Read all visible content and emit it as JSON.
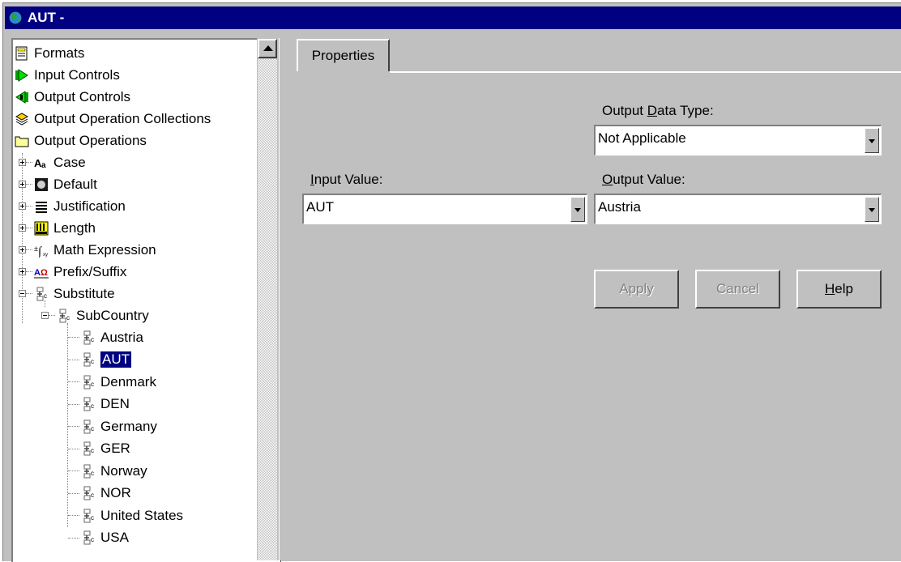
{
  "window": {
    "title": "AUT -"
  },
  "tree": {
    "top_items": [
      {
        "label": "Formats",
        "icon": "formats-icon"
      },
      {
        "label": "Input Controls",
        "icon": "input-controls-icon"
      },
      {
        "label": "Output Controls",
        "icon": "output-controls-icon"
      },
      {
        "label": "Output Operation Collections",
        "icon": "collections-icon"
      },
      {
        "label": "Output Operations",
        "icon": "folder-icon"
      }
    ],
    "operations": [
      {
        "label": "Case",
        "icon": "case-icon"
      },
      {
        "label": "Default",
        "icon": "default-icon"
      },
      {
        "label": "Justification",
        "icon": "justification-icon"
      },
      {
        "label": "Length",
        "icon": "length-icon"
      },
      {
        "label": "Math Expression",
        "icon": "math-expression-icon"
      },
      {
        "label": "Prefix/Suffix",
        "icon": "prefix-suffix-icon"
      },
      {
        "label": "Substitute",
        "icon": "substitute-icon"
      }
    ],
    "subgroup": {
      "label": "SubCountry",
      "icon": "substitute-icon"
    },
    "values": [
      "Austria",
      "AUT",
      "Denmark",
      "DEN",
      "Germany",
      "GER",
      "Norway",
      "NOR",
      "United States",
      "USA"
    ],
    "selected": "AUT"
  },
  "properties": {
    "tab_label": "Properties",
    "output_data_type_label_pre": "Output ",
    "output_data_type_label_u": "D",
    "output_data_type_label_post": "ata Type:",
    "output_data_type_value": "Not Applicable",
    "input_value_label_u": "I",
    "input_value_label_post": "nput Value:",
    "input_value": "AUT",
    "output_value_label_u": "O",
    "output_value_label_post": "utput Value:",
    "output_value": "Austria",
    "apply_label": "Apply",
    "cancel_label": "Cancel",
    "help_label_u": "H",
    "help_label_post": "elp"
  }
}
